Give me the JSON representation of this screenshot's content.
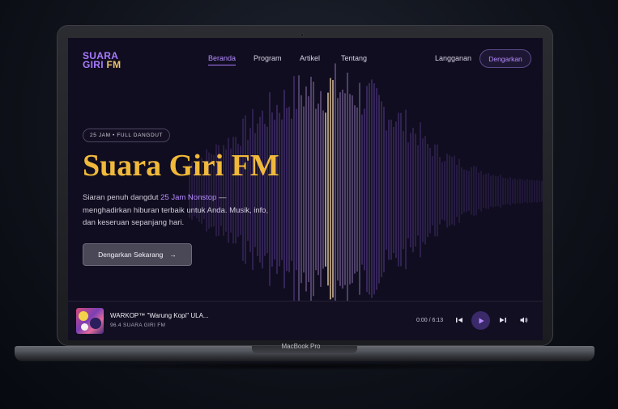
{
  "device_label": "MacBook Pro",
  "logo": {
    "line1": "SUARA",
    "line2a": "GIRI",
    "line2b": "FM"
  },
  "nav": {
    "items": [
      {
        "label": "Beranda"
      },
      {
        "label": "Program"
      },
      {
        "label": "Artikel"
      },
      {
        "label": "Tentang"
      }
    ],
    "subscribe": "Langganan",
    "listen_button": "Dengarkan"
  },
  "hero": {
    "badge": "25 JAM • FULL DANGDUT",
    "title": "Suara Giri FM",
    "desc_pre": "Siaran penuh dangdut ",
    "desc_highlight": "25 Jam Nonstop",
    "desc_post": " — menghadirkan hiburan terbaik untuk Anda. Musik, info, dan keseruan sepanjang hari.",
    "cta": "Dengarkan Sekarang",
    "cta_arrow": "→"
  },
  "player": {
    "track_title": "WARKOP™ \"Warung Kopi\" ULA...",
    "station": "96.4 SUARA GIRI FM",
    "time": "0:00 / 6:13",
    "icons": [
      "previous-icon",
      "play-icon",
      "next-icon",
      "volume-icon"
    ]
  },
  "colors": {
    "accent": "#a77bff",
    "title_gold": "#f0b93a",
    "background": "#110d20"
  }
}
